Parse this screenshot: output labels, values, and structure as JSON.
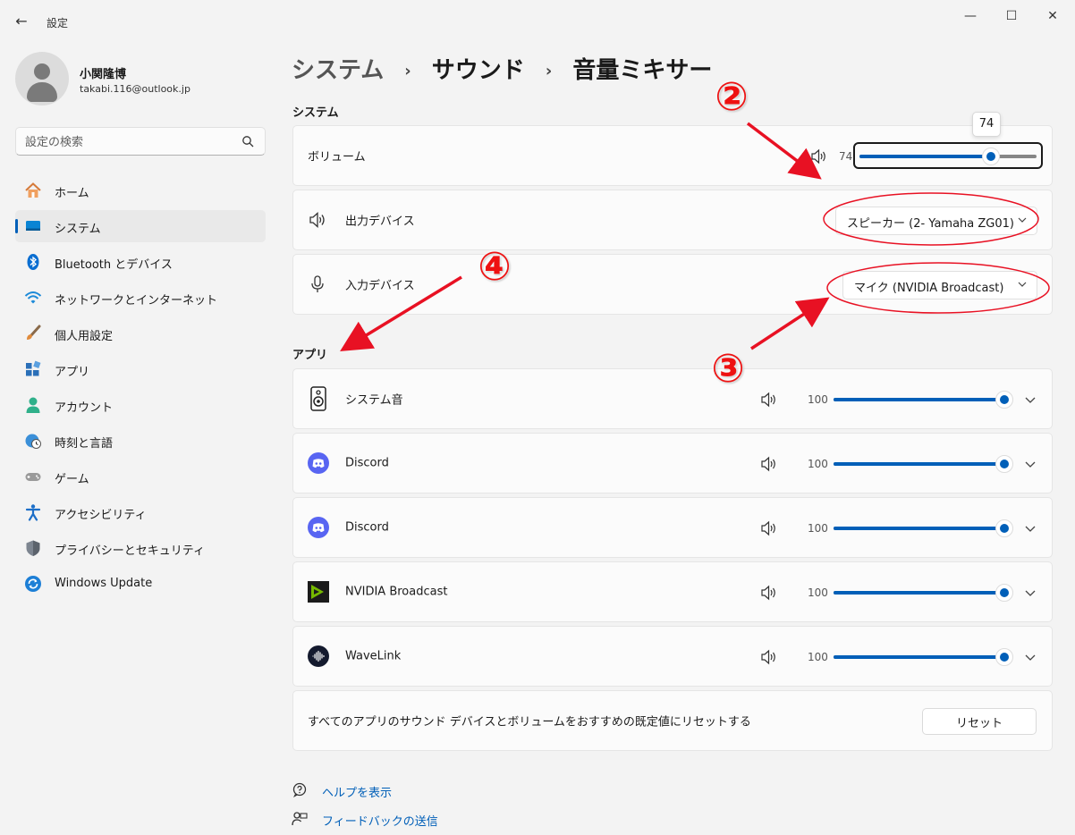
{
  "window": {
    "title": "設定",
    "back_icon": "←",
    "minimize_icon": "—",
    "maximize_icon": "☐",
    "close_icon": "✕"
  },
  "profile": {
    "name": "小関隆博",
    "email": "takabi.116@outlook.jp"
  },
  "search": {
    "placeholder": "設定の検索"
  },
  "nav": {
    "items": [
      {
        "label": "ホーム",
        "icon": "home-icon"
      },
      {
        "label": "システム",
        "icon": "system-icon",
        "active": true
      },
      {
        "label": "Bluetooth とデバイス",
        "icon": "bluetooth-icon"
      },
      {
        "label": "ネットワークとインターネット",
        "icon": "wifi-icon"
      },
      {
        "label": "個人用設定",
        "icon": "brush-icon"
      },
      {
        "label": "アプリ",
        "icon": "apps-icon"
      },
      {
        "label": "アカウント",
        "icon": "account-icon"
      },
      {
        "label": "時刻と言語",
        "icon": "clock-globe-icon"
      },
      {
        "label": "ゲーム",
        "icon": "gamepad-icon"
      },
      {
        "label": "アクセシビリティ",
        "icon": "accessibility-icon"
      },
      {
        "label": "プライバシーとセキュリティ",
        "icon": "shield-icon"
      },
      {
        "label": "Windows Update",
        "icon": "update-icon"
      }
    ]
  },
  "breadcrumb": {
    "items": [
      "システム",
      "サウンド",
      "音量ミキサー"
    ],
    "separator": "›"
  },
  "system_section": {
    "label": "システム",
    "volume": {
      "label": "ボリューム",
      "value": "74",
      "level": 74,
      "tooltip": "74"
    },
    "output": {
      "label": "出力デバイス",
      "selected": "スピーカー (2- Yamaha ZG01)"
    },
    "input": {
      "label": "入力デバイス",
      "selected": "マイク (NVIDIA Broadcast)"
    }
  },
  "apps_section": {
    "label": "アプリ",
    "apps": [
      {
        "name": "システム音",
        "volume": "100",
        "level": 100,
        "icon": "system-sounds-icon"
      },
      {
        "name": "Discord",
        "volume": "100",
        "level": 100,
        "icon": "discord-icon"
      },
      {
        "name": "Discord",
        "volume": "100",
        "level": 100,
        "icon": "discord-icon"
      },
      {
        "name": "NVIDIA Broadcast",
        "volume": "100",
        "level": 100,
        "icon": "nvidia-broadcast-icon"
      },
      {
        "name": "WaveLink",
        "volume": "100",
        "level": 100,
        "icon": "wavelink-icon"
      }
    ],
    "reset_text": "すべてのアプリのサウンド デバイスとボリュームをおすすめの既定値にリセットする",
    "reset_button": "リセット"
  },
  "footer": {
    "help": "ヘルプを表示",
    "feedback": "フィードバックの送信"
  },
  "annotations": {
    "marks": [
      "②",
      "③",
      "④"
    ],
    "color": "#e81123"
  },
  "colors": {
    "accent": "#005fb8",
    "annotation": "#e81123"
  }
}
